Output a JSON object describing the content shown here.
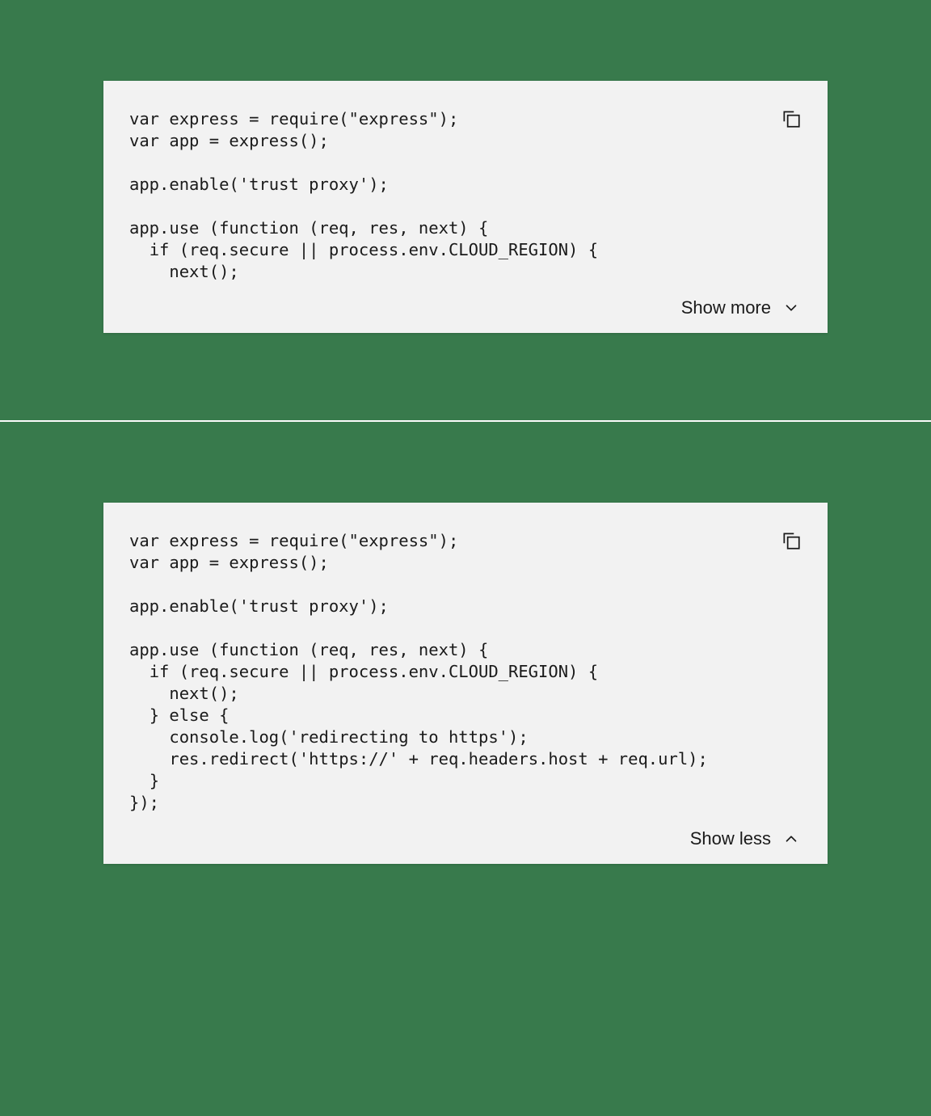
{
  "blocks": [
    {
      "code": "var express = require(\"express\");\nvar app = express();\n\napp.enable('trust proxy');\n\napp.use (function (req, res, next) {\n  if (req.secure || process.env.CLOUD_REGION) {\n    next();",
      "toggle_label": "Show more",
      "expanded": false
    },
    {
      "code": "var express = require(\"express\");\nvar app = express();\n\napp.enable('trust proxy');\n\napp.use (function (req, res, next) {\n  if (req.secure || process.env.CLOUD_REGION) {\n    next();\n  } else {\n    console.log('redirecting to https');\n    res.redirect('https://' + req.headers.host + req.url);\n  }\n});",
      "toggle_label": "Show less",
      "expanded": true
    }
  ]
}
